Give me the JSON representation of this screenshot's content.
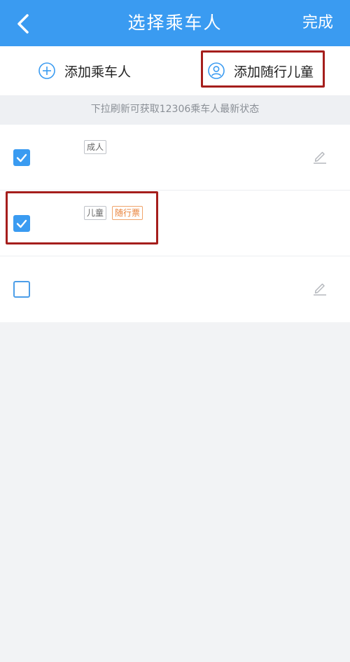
{
  "header": {
    "title": "选择乘车人",
    "done_label": "完成"
  },
  "actions": {
    "add_passenger": "添加乘车人",
    "add_child": "添加随行儿童"
  },
  "hint": "下拉刷新可获取12306乘车人最新状态",
  "passengers": [
    {
      "checked": true,
      "tags": [
        "成人"
      ]
    },
    {
      "checked": true,
      "tags": [
        "儿童",
        "随行票"
      ]
    },
    {
      "checked": false,
      "tags": []
    }
  ],
  "colors": {
    "primary": "#3a9bf1",
    "highlight": "#a51e1c",
    "tag_orange": "#e9823a"
  }
}
